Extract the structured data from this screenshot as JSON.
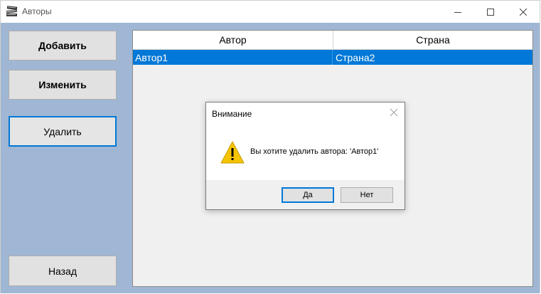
{
  "window": {
    "title": "Авторы",
    "icon": "books-icon"
  },
  "sidebar": {
    "add_label": "Добавить",
    "edit_label": "Изменить",
    "delete_label": "Удалить",
    "back_label": "Назад"
  },
  "grid": {
    "columns": [
      "Автор",
      "Страна"
    ],
    "rows": [
      {
        "author": "Автор1",
        "country": "Страна2",
        "selected": true
      }
    ]
  },
  "dialog": {
    "title": "Внимание",
    "message": "Вы хотите удалить автора: 'Автор1'",
    "icon": "warning-icon",
    "yes_label": "Да",
    "no_label": "Нет"
  },
  "colors": {
    "selection": "#0078d7",
    "client_background": "#9fb7d4",
    "warning": "#f5c400"
  }
}
